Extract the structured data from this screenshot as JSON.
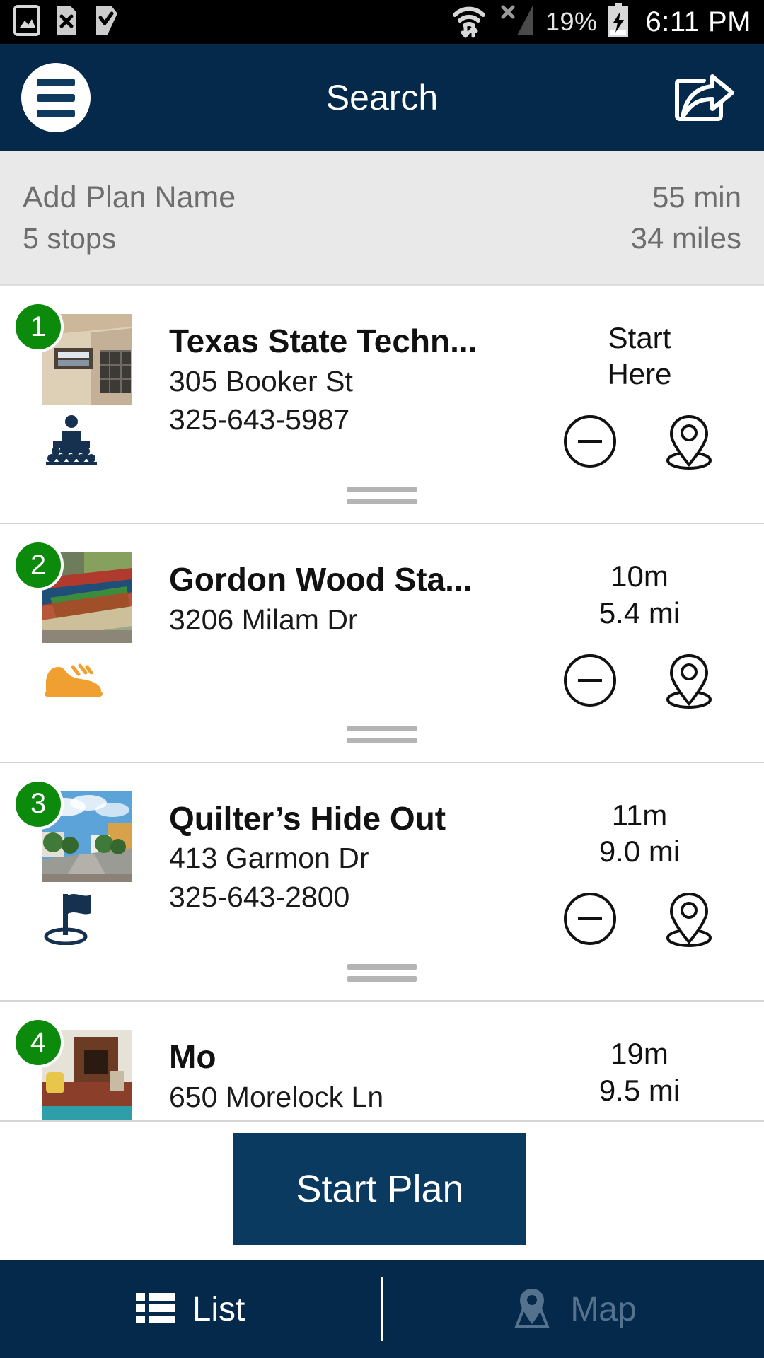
{
  "status_bar": {
    "time": "6:11 PM",
    "battery_percent": "19%",
    "left_icons": [
      "image-icon",
      "sim-error-icon",
      "checkmark-tag-icon"
    ],
    "right_icons": [
      "wifi-transfer-icon",
      "no-signal-icon",
      "charging-battery-icon"
    ]
  },
  "header": {
    "title": "Search",
    "menu_icon": "hamburger-menu-icon",
    "share_icon": "share-icon"
  },
  "plan_summary": {
    "name": "Add Plan Name",
    "stops": "5 stops",
    "duration": "55 min",
    "distance": "34 miles"
  },
  "stops": [
    {
      "number": "1",
      "title": "Texas State Techn...",
      "address": "305 Booker St",
      "phone": "325-643-5987",
      "meta_line1": "Start",
      "meta_line2": "Here",
      "category_icon": "lecture-presentation-icon",
      "thumb_alt": "building-photo",
      "remove_icon": "minus-circle-icon",
      "locate_icon": "map-pin-icon"
    },
    {
      "number": "2",
      "title": "Gordon Wood Sta...",
      "address": "3206 Milam Dr",
      "phone": "",
      "meta_line1": "10m",
      "meta_line2": "5.4 mi",
      "category_icon": "sneaker-icon",
      "thumb_alt": "stadium-photo",
      "remove_icon": "minus-circle-icon",
      "locate_icon": "map-pin-icon"
    },
    {
      "number": "3",
      "title": "Quilter’s Hide Out",
      "address": "413 Garmon Dr",
      "phone": "325-643-2800",
      "meta_line1": "11m",
      "meta_line2": "9.0 mi",
      "category_icon": "flag-icon",
      "thumb_alt": "street-photo",
      "remove_icon": "minus-circle-icon",
      "locate_icon": "map-pin-icon"
    },
    {
      "number": "4",
      "title": "Mo",
      "address": "650 Morelock Ln",
      "phone": "",
      "meta_line1": "19m",
      "meta_line2": "9.5 mi",
      "category_icon": "",
      "thumb_alt": "interior-photo",
      "remove_icon": "minus-circle-icon",
      "locate_icon": "map-pin-icon"
    }
  ],
  "start_plan_button": {
    "label": "Start Plan"
  },
  "bottom_nav": {
    "list_label": "List",
    "list_icon": "list-icon",
    "map_label": "Map",
    "map_icon": "map-pin-icon"
  },
  "colors": {
    "header_navy": "#04294b",
    "badge_green": "#0b8a0b",
    "summary_gray": "#e9e9e9",
    "accent_orange": "#f0a030",
    "button_navy": "#0b3a61",
    "inactive_nav": "#54718d"
  }
}
